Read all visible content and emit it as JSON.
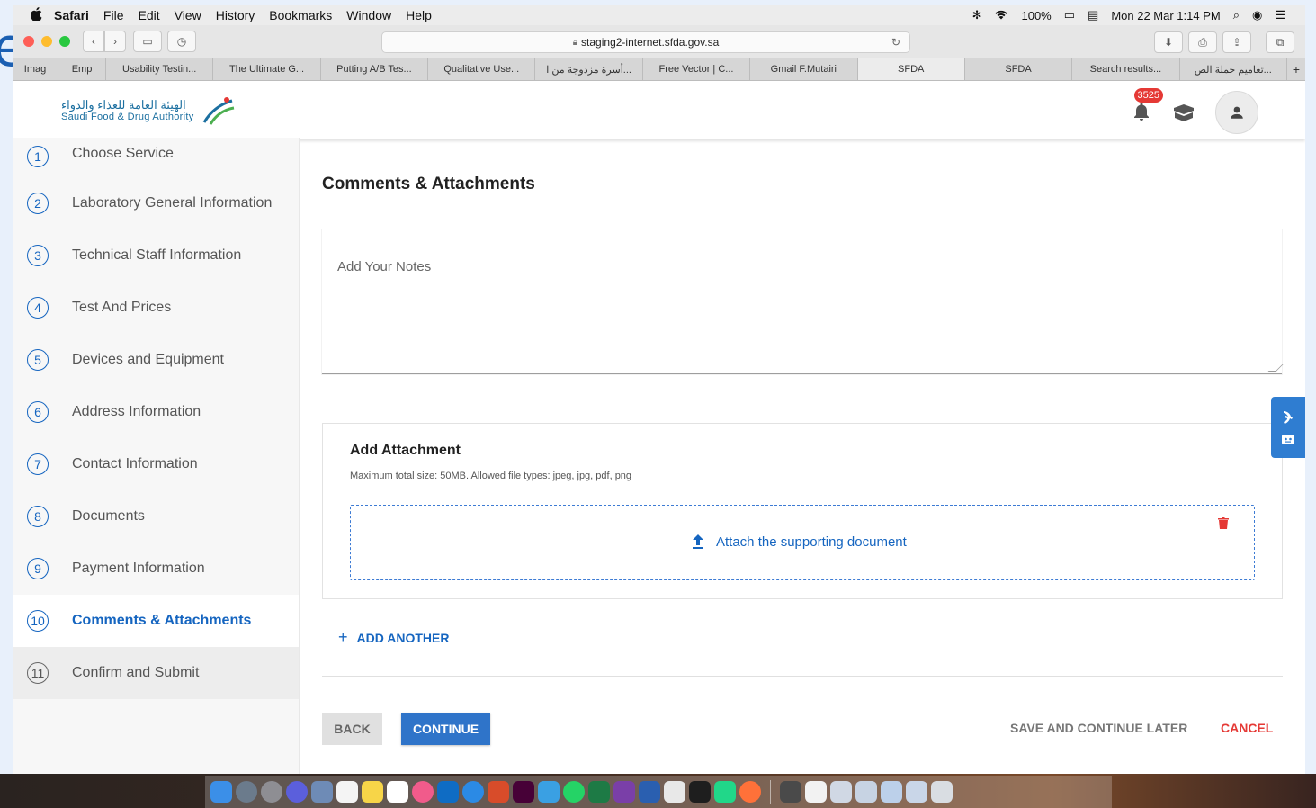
{
  "menubar": {
    "app": "Safari",
    "items": [
      "File",
      "Edit",
      "View",
      "History",
      "Bookmarks",
      "Window",
      "Help"
    ],
    "battery": "100%",
    "clock": "Mon 22 Mar  1:14 PM"
  },
  "browser": {
    "url": "staging2-internet.sfda.gov.sa",
    "tabs": [
      "Imag",
      "Emp",
      "Usability Testin...",
      "The Ultimate G...",
      "Putting A/B Tes...",
      "Qualitative Use...",
      "أسرة مزدوجة من ا...",
      "Free Vector | C...",
      "Gmail F.Mutairi",
      "SFDA",
      "SFDA",
      "Search results...",
      "تعاميم حملة الص..."
    ],
    "active_tab_index": 9
  },
  "header": {
    "logo_ar": "الهيئة العامة للغذاء والدواء",
    "logo_en": "Saudi Food & Drug Authority",
    "notification_count": "3525"
  },
  "steps": [
    {
      "num": "1",
      "label": "Choose Service"
    },
    {
      "num": "2",
      "label": "Laboratory General Information"
    },
    {
      "num": "3",
      "label": "Technical Staff Information"
    },
    {
      "num": "4",
      "label": "Test And Prices"
    },
    {
      "num": "5",
      "label": "Devices and Equipment"
    },
    {
      "num": "6",
      "label": "Address Information"
    },
    {
      "num": "7",
      "label": "Contact Information"
    },
    {
      "num": "8",
      "label": "Documents"
    },
    {
      "num": "9",
      "label": "Payment Information"
    },
    {
      "num": "10",
      "label": "Comments & Attachments"
    },
    {
      "num": "11",
      "label": "Confirm and Submit"
    }
  ],
  "main": {
    "title": "Comments & Attachments",
    "notes_placeholder": "Add Your Notes",
    "attachment_title": "Add Attachment",
    "attachment_hint": "Maximum total size: 50MB. Allowed file types: jpeg, jpg, pdf, png",
    "attach_label": "Attach the supporting document",
    "add_another": "ADD ANOTHER",
    "back": "BACK",
    "continue": "CONTINUE",
    "save_later": "SAVE AND CONTINUE LATER",
    "cancel": "CANCEL"
  },
  "colors": {
    "primary": "#1565c0",
    "button_primary": "#2f74c9",
    "danger": "#e53935"
  }
}
